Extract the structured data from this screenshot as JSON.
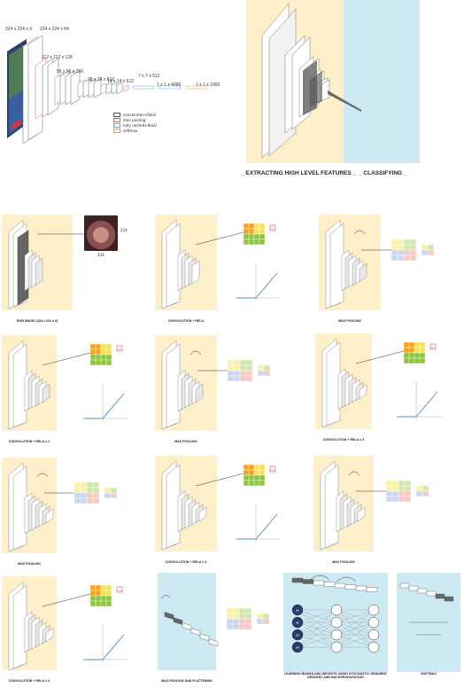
{
  "arch": {
    "dims": [
      "224 x 224 x 3",
      "224 x 224 x 64",
      "112 x 112 x 128",
      "56 x 56 x 256",
      "28 x 28 x 512",
      "14 x 14 x 512",
      "7 x 7 x 512",
      "1 x 1 x 4096",
      "1 x 1 x 1000"
    ],
    "legend": [
      {
        "label": "convolution+ReLU",
        "color": "#ffffff",
        "border": "#555555"
      },
      {
        "label": "max pooling",
        "color": "#ffffff",
        "border": "#e06060"
      },
      {
        "label": "fully nected+ReLU",
        "color": "#ffffff",
        "border": "#5aaee0"
      },
      {
        "label": "softmax",
        "color": "#ffffff",
        "border": "#e0a040"
      }
    ]
  },
  "overview": {
    "extract_label": "_ EXTRACTING HIGH LEVEL FEATURES _",
    "classify_label": "_ CLASSIFYING _"
  },
  "steps": {
    "input": {
      "caption": "RGB IMAGE (224 x 224 x 3)",
      "size_a": "224",
      "size_b": "224"
    },
    "conv1": {
      "caption": "CONVOLUTION + RELU"
    },
    "pool1": {
      "caption": "MAX POOLING"
    },
    "conv2": {
      "caption": "CONVOLUTION + RELU x 2"
    },
    "pool2": {
      "caption": "MAX POOLING"
    },
    "conv3": {
      "caption": "CONVOLUTION + RELU x 3"
    },
    "pool3": {
      "caption": "MAX POOLING"
    },
    "conv4": {
      "caption": "CONVOLUTION + RELU x 3"
    },
    "pool4": {
      "caption": "MAX POOLING"
    },
    "conv5": {
      "caption": "CONVOLUTION + RELU x 3"
    },
    "flatten": {
      "caption": "MAX POOLING AND FLATTENING"
    },
    "dense": {
      "caption": "LEARNING BIASES AND WEIGHTS USING STOCHASTIC GRADIENT DESCENT AND BACKPROPAGATION"
    },
    "softmax": {
      "caption": "SOFTMAX"
    }
  },
  "nodes": [
    "a1",
    "a2",
    "a3",
    "a4"
  ],
  "colors": {
    "yellow_bg": "#fcefc9",
    "blue_bg": "#cdeaf2",
    "relu_line": "#4a90c8",
    "grid_green": "#8cc63f",
    "grid_orange": "#f7a21b",
    "grid_yellow": "#f5e05a",
    "pool_red": "#f9c9c4",
    "pool_yellow": "#fbf0a8",
    "pool_green": "#cfe8b0",
    "pool_blue": "#c9d8f2"
  }
}
